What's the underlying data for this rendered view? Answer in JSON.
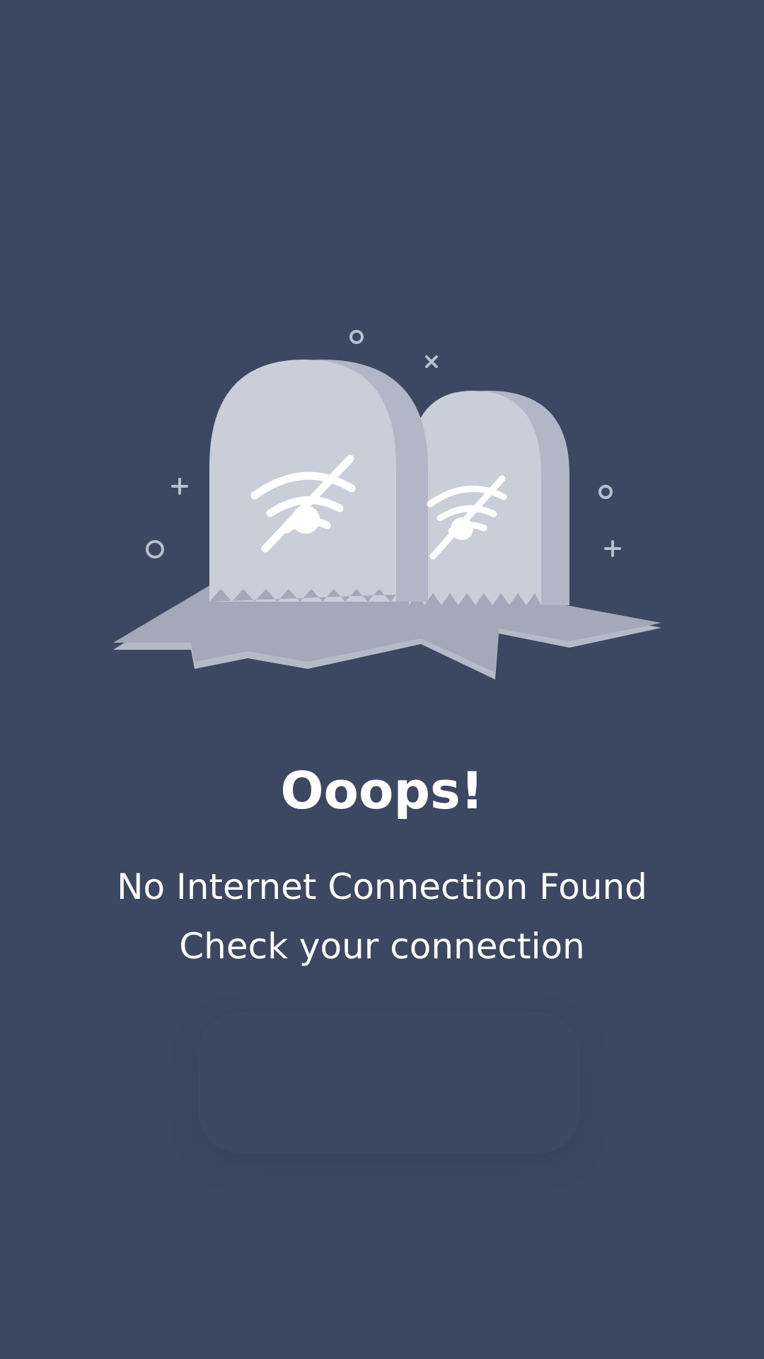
{
  "error": {
    "title": "Ooops!",
    "message_line1": "No Internet Connection Found",
    "message_line2": "Check your connection"
  },
  "colors": {
    "background": "#3c4862",
    "tombstone_face": "#c9ced8",
    "tombstone_side": "#b1b7c6",
    "ground": "#a3a9b8",
    "ground_dark": "#b4bac8",
    "sparkle": "#b8bfcd",
    "text": "#ffffff"
  },
  "icons": [
    "wifi-off-icon",
    "wifi-off-icon",
    "circle-sparkle",
    "x-sparkle",
    "plus-sparkle"
  ]
}
